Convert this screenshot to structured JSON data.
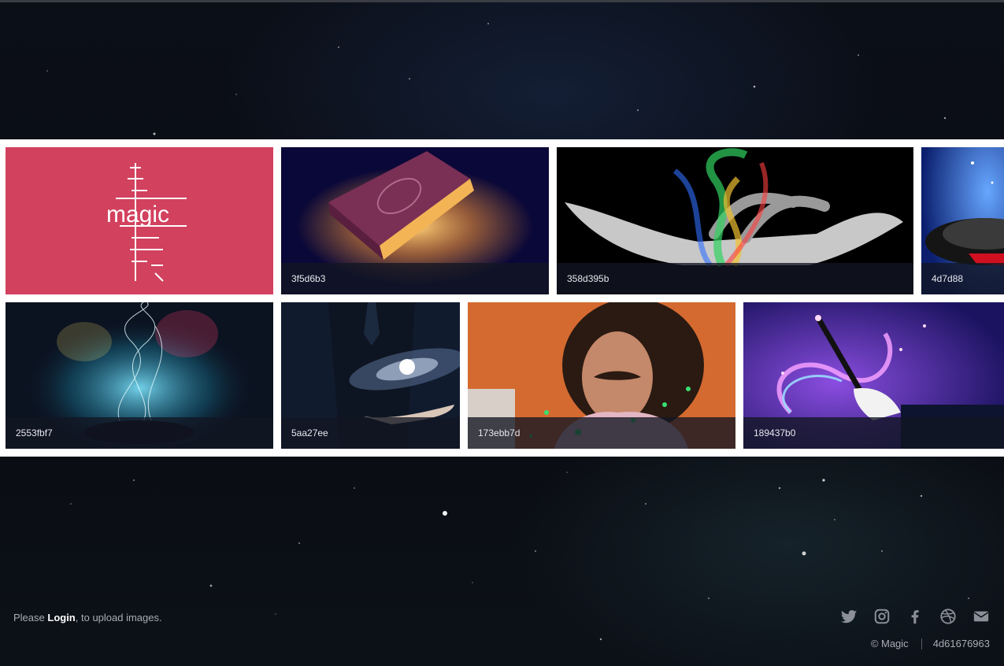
{
  "gallery": {
    "tiles": [
      {
        "caption": "",
        "art": "magic-logo"
      },
      {
        "caption": "3f5d6b3",
        "art": "glowing-book"
      },
      {
        "caption": "358d395b",
        "art": "hand-smoke"
      },
      {
        "caption": "4d7d88",
        "art": "magic-hat"
      },
      {
        "caption": "2553fbf7",
        "art": "light-swirls"
      },
      {
        "caption": "5aa27ee",
        "art": "galaxy-hand"
      },
      {
        "caption": "173ebb7d",
        "art": "magician-portrait"
      },
      {
        "caption": "189437b0",
        "art": "magic-wand"
      }
    ]
  },
  "logo_text": "magic",
  "footer": {
    "prefix": "Please ",
    "login_label": "Login",
    "suffix": ", to upload images.",
    "copyright": "© Magic",
    "version": "4d61676963",
    "social_icons": [
      "twitter-icon",
      "instagram-icon",
      "facebook-icon",
      "dribbble-icon",
      "mail-icon"
    ]
  },
  "colors": {
    "logo_bg": "#d2415e",
    "caption_bg": "#121622",
    "icon": "#8a8f98"
  }
}
